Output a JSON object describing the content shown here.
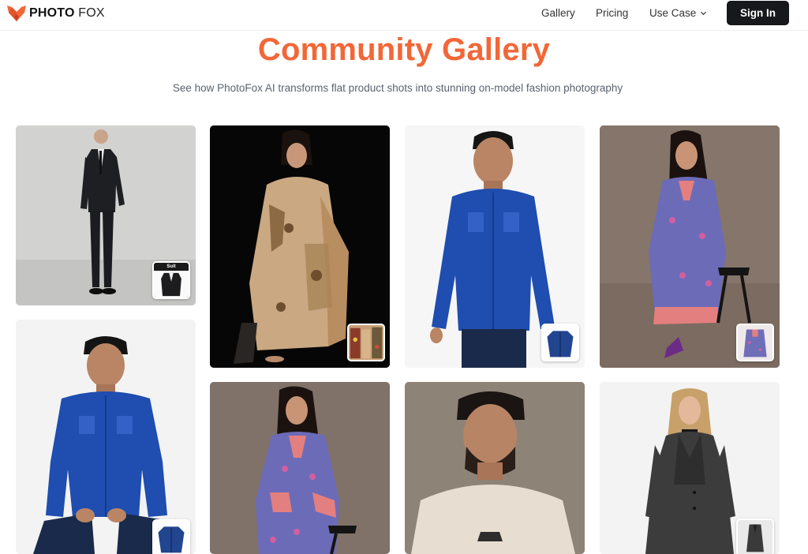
{
  "header": {
    "logo_bold": "PHOTO",
    "logo_light": "FOX",
    "nav": {
      "gallery": "Gallery",
      "pricing": "Pricing",
      "use_case": "Use Case"
    },
    "sign_in": "Sign In"
  },
  "hero": {
    "title": "Community Gallery",
    "subtitle": "See how PhotoFox AI transforms flat product shots into stunning on-model fashion photography"
  },
  "gallery": {
    "items": [
      {
        "name": "man-in-black-suit",
        "thumb_label": "Suit"
      },
      {
        "name": "woman-beige-printed-dress",
        "thumb_label": ""
      },
      {
        "name": "man-denim-shirt-standing",
        "thumb_label": ""
      },
      {
        "name": "woman-floral-kurta-seated",
        "thumb_label": ""
      },
      {
        "name": "man-denim-shirt-seated",
        "thumb_label": ""
      },
      {
        "name": "woman-floral-kurta",
        "thumb_label": ""
      },
      {
        "name": "man-cream-tshirt",
        "thumb_label": ""
      },
      {
        "name": "woman-grey-coat",
        "thumb_label": ""
      }
    ]
  },
  "colors": {
    "brand_orange": "#f26738",
    "button_dark": "#17181b"
  },
  "icons": [
    "fox-logo-icon",
    "chevron-down-icon"
  ]
}
